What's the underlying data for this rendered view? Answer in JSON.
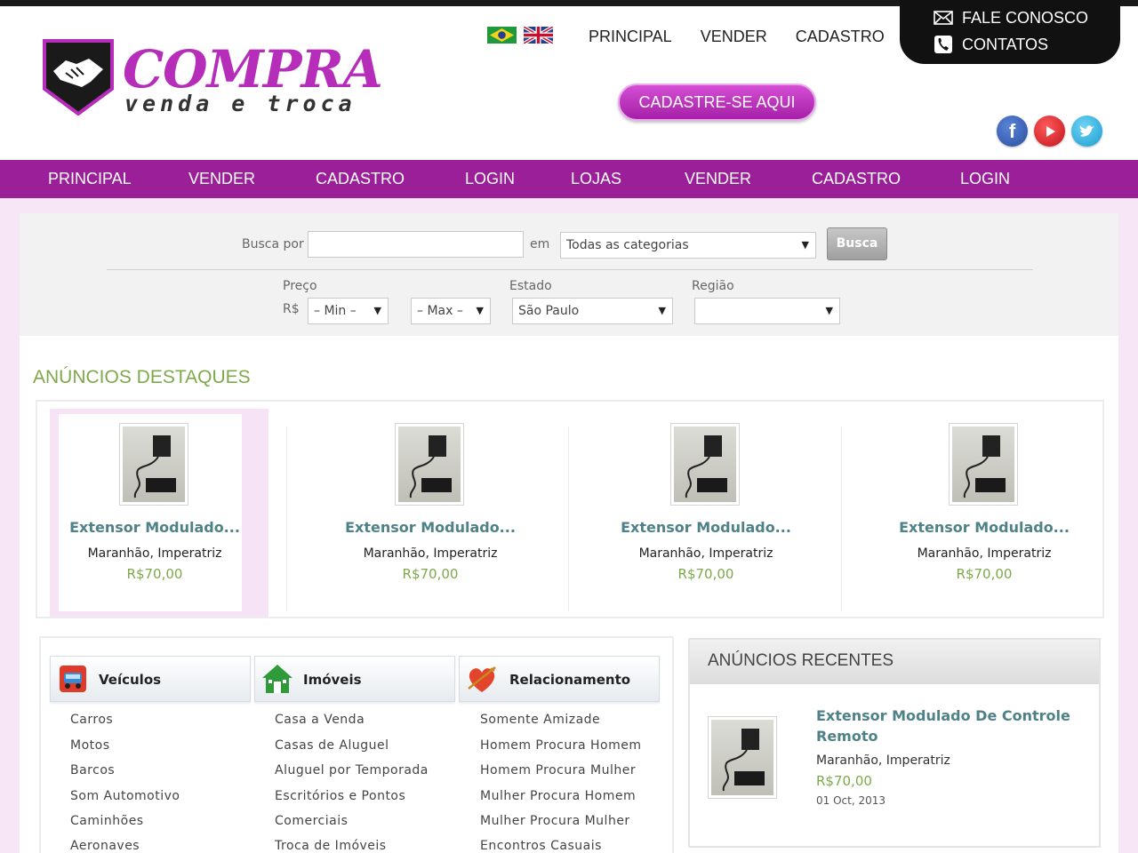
{
  "brand": {
    "word": "COMPRA",
    "sub": "venda e troca"
  },
  "flags": [
    "flag-brazil",
    "flag-uk"
  ],
  "top_nav": [
    "PRINCIPAL",
    "VENDER",
    "CADASTRO"
  ],
  "contact": {
    "fale": "FALE CONOSCO",
    "contatos": "CONTATOS"
  },
  "cta": "CADASTRE-SE AQUI",
  "social": {
    "facebook": "f",
    "youtube": "youtube-icon",
    "twitter": "twitter-icon"
  },
  "main_nav": [
    "PRINCIPAL",
    "VENDER",
    "CADASTRO",
    "LOGIN",
    "LOJAS",
    "VENDER",
    "CADASTRO",
    "LOGIN"
  ],
  "search": {
    "busca_label": "Busca por",
    "busca_value": "",
    "em_label": "em",
    "category": "Todas as categorias",
    "button": "Busca",
    "preco_label": "Preço",
    "currency": "R$",
    "min": "– Min –",
    "max": "– Max –",
    "estado_label": "Estado",
    "estado": "São Paulo",
    "regiao_label": "Região",
    "regiao": ""
  },
  "featured": {
    "title": "ANÚNCIOS DESTAQUES",
    "items": [
      {
        "title": "Extensor Modulado...",
        "location": "Maranhão, Imperatriz",
        "price": "R$70,00"
      },
      {
        "title": "Extensor Modulado...",
        "location": "Maranhão, Imperatriz",
        "price": "R$70,00"
      },
      {
        "title": "Extensor Modulado...",
        "location": "Maranhão, Imperatriz",
        "price": "R$70,00"
      },
      {
        "title": "Extensor Modulado...",
        "location": "Maranhão, Imperatriz",
        "price": "R$70,00"
      }
    ]
  },
  "categories": [
    {
      "title": "Veículos",
      "icon": "car-icon",
      "items": [
        "Carros",
        "Motos",
        "Barcos",
        "Som Automotivo",
        "Caminhões",
        "Aeronaves"
      ]
    },
    {
      "title": "Imóveis",
      "icon": "house-icon",
      "items": [
        "Casa a Venda",
        "Casas de Aluguel",
        "Aluguel por Temporada",
        "Escritórios e Pontos",
        "Comerciais",
        "Troca de Imóveis"
      ]
    },
    {
      "title": "Relacionamento",
      "icon": "heart-icon",
      "items": [
        "Somente Amizade",
        "Homem Procura Homem",
        "Homem Procura Mulher",
        "Mulher Procura Homem",
        "Mulher Procura Mulher",
        "Encontros Casuais"
      ]
    }
  ],
  "recent": {
    "title": "ANÚNCIOS RECENTES",
    "item": {
      "title": "Extensor Modulado De Controle Remoto",
      "location": "Maranhão, Imperatriz",
      "price": "R$70,00",
      "date": "01 Oct, 2013"
    }
  },
  "colors": {
    "brand_purple": "#9b1f99",
    "accent_green": "#7fa84a",
    "title_teal": "#4f8288"
  }
}
